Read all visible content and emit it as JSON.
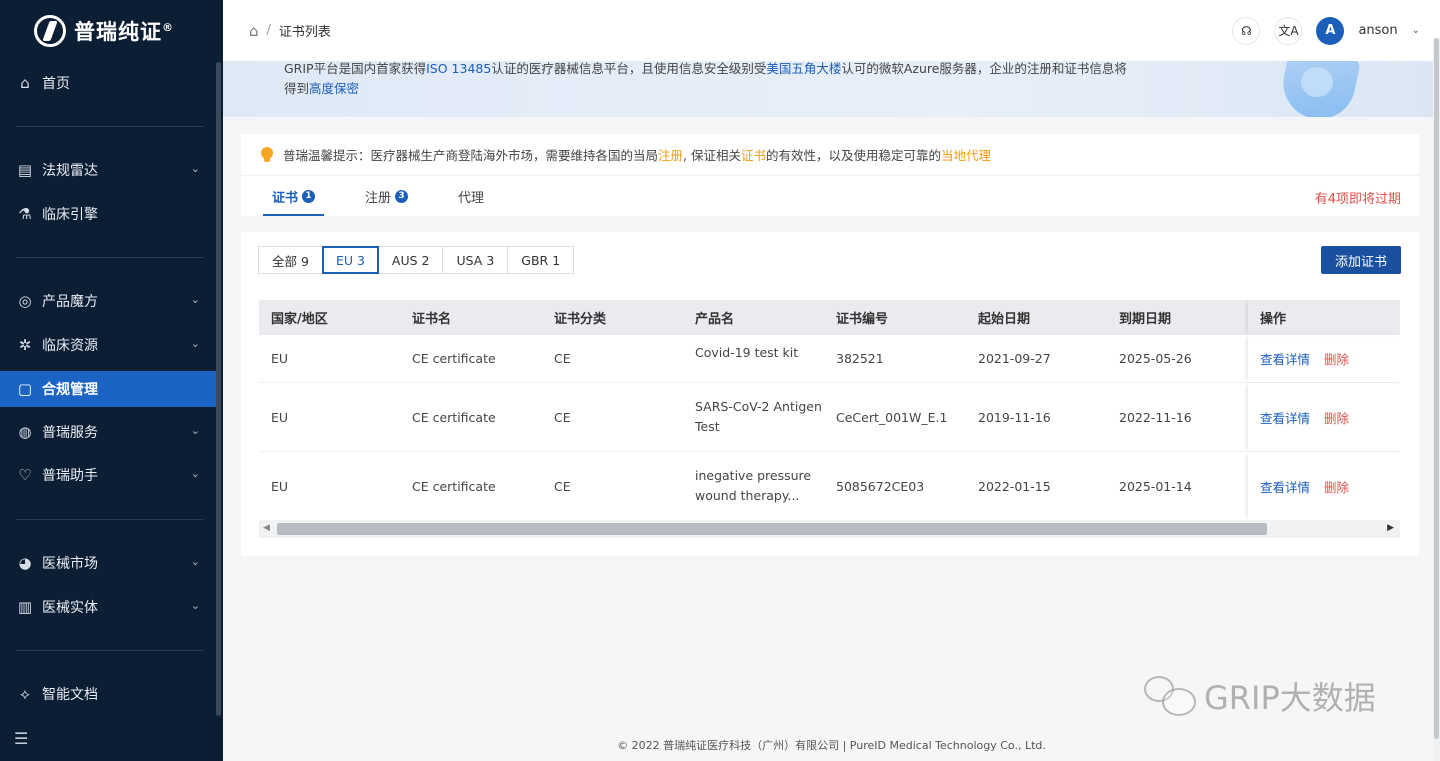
{
  "brand": {
    "name": "普瑞纯证",
    "reg": "®"
  },
  "sidebar": {
    "items": [
      {
        "label": "首页",
        "icon": "home-icon",
        "glyph": "⌂",
        "chevron": false
      },
      {
        "label": "法规雷达",
        "icon": "radar-icon",
        "glyph": "▤",
        "chevron": true
      },
      {
        "label": "临床引擎",
        "icon": "flask-icon",
        "glyph": "⚗",
        "chevron": false
      },
      {
        "label": "产品魔方",
        "icon": "cube-icon",
        "glyph": "◎",
        "chevron": true
      },
      {
        "label": "临床资源",
        "icon": "gear-icon",
        "glyph": "✲",
        "chevron": true
      },
      {
        "label": "合规管理",
        "icon": "compliance-icon",
        "glyph": "▢",
        "chevron": false
      },
      {
        "label": "普瑞服务",
        "icon": "service-icon",
        "glyph": "◍",
        "chevron": true
      },
      {
        "label": "普瑞助手",
        "icon": "heart-icon",
        "glyph": "♡",
        "chevron": true
      },
      {
        "label": "医械市场",
        "icon": "market-icon",
        "glyph": "◕",
        "chevron": true
      },
      {
        "label": "医械实体",
        "icon": "building-icon",
        "glyph": "▥",
        "chevron": true
      },
      {
        "label": "智能文档",
        "icon": "document-icon",
        "glyph": "⟡",
        "chevron": false
      }
    ],
    "active_index": 5
  },
  "header": {
    "breadcrumb_sep": "/",
    "breadcrumb_current": "证书列表",
    "username": "anson",
    "avatar_letter": "A"
  },
  "banner": {
    "p1": "GRIP平台是国内首家获得",
    "h1": "ISO 13485",
    "p2": "认证的医疗器械信息平台，且使用信息安全级别受",
    "h2": "美国五角大楼",
    "p3": "认可的微软Azure服务器，企业的注册和证书信息将",
    "p4": "得到",
    "h3": "高度保密"
  },
  "tip": {
    "t1": "普瑞温馨提示：医疗器械生产商登陆海外市场，需要维持各国的当局",
    "o1": "注册",
    "t2": ", 保证相关",
    "o2": "证书",
    "t3": "的有效性，以及使用稳定可靠的",
    "o3": "当地代理"
  },
  "tabs": [
    {
      "label": "证书",
      "badge": "1"
    },
    {
      "label": "注册",
      "badge": "3"
    },
    {
      "label": "代理",
      "badge": ""
    }
  ],
  "expire_notice": "有4项即将过期",
  "filters": [
    "全部 9",
    "EU 3",
    "AUS 2",
    "USA 3",
    "GBR 1"
  ],
  "filter_active": 1,
  "add_button": "添加证书",
  "table": {
    "headers": [
      "国家/地区",
      "证书名",
      "证书分类",
      "产品名",
      "证书编号",
      "起始日期",
      "到期日期",
      "操作"
    ],
    "rows": [
      {
        "country": "EU",
        "name": "CE certificate",
        "category": "CE",
        "product_l1": "Covid-19 test kit",
        "product_l2": "",
        "number": "382521",
        "start": "2021-09-27",
        "end": "2025-05-26"
      },
      {
        "country": "EU",
        "name": "CE certificate",
        "category": "CE",
        "product_l1": "SARS-CoV-2 Antigen",
        "product_l2": "Test",
        "number": "CeCert_001W_E.1",
        "start": "2019-11-16",
        "end": "2022-11-16"
      },
      {
        "country": "EU",
        "name": "CE certificate",
        "category": "CE",
        "product_l1": "inegative pressure",
        "product_l2": "wound therapy...",
        "number": "5085672CE03",
        "start": "2022-01-15",
        "end": "2025-01-14"
      }
    ],
    "action_view": "查看详情",
    "action_delete": "删除"
  },
  "footer": "© 2022 普瑞纯证医疗科技（广州）有限公司 | PureID Medical Technology Co., Ltd.",
  "watermark": "GRIP大数据"
}
